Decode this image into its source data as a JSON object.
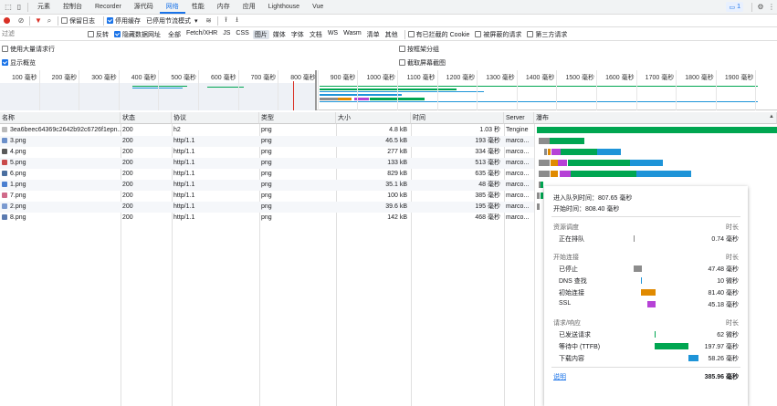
{
  "tabs": [
    "元素",
    "控制台",
    "Recorder",
    "源代码",
    "网络",
    "性能",
    "内存",
    "应用",
    "Lighthouse",
    "Vue"
  ],
  "active_tab": "网络",
  "issues_badge": "1",
  "toolbar": {
    "preserve_log": "保留日志",
    "disable_cache": "停用缓存",
    "throttling": "已停用节流模式"
  },
  "filter": {
    "placeholder": "过滤",
    "invert": "反转",
    "hide_data_urls": "隐藏数据网址",
    "types": [
      "全部",
      "Fetch/XHR",
      "JS",
      "CSS",
      "图片",
      "媒体",
      "字体",
      "文档",
      "WS",
      "Wasm",
      "清单",
      "其他"
    ],
    "active_type": "图片",
    "blocked_cookies": "有已拦截的 Cookie",
    "blocked_requests": "被屏蔽的请求",
    "third_party": "第三方请求"
  },
  "options": {
    "large_rows": "使用大量请求行",
    "group_by_frame": "按框架分组",
    "show_overview": "显示概览",
    "capture_screenshots": "截取屏幕截图"
  },
  "overview_ticks": [
    "100 毫秒",
    "200 毫秒",
    "300 毫秒",
    "400 毫秒",
    "500 毫秒",
    "600 毫秒",
    "700 毫秒",
    "800 毫秒",
    "900 毫秒",
    "1000 毫秒",
    "1100 毫秒",
    "1200 毫秒",
    "1300 毫秒",
    "1400 毫秒",
    "1500 毫秒",
    "1600 毫秒",
    "1700 毫秒",
    "1800 毫秒",
    "1900 毫秒",
    "2000"
  ],
  "columns": [
    "名称",
    "状态",
    "协议",
    "类型",
    "大小",
    "时间",
    "Server",
    "瀑布"
  ],
  "rows": [
    {
      "name": "3ea6beec64369c2642b92c6726f1epn...",
      "status": "200",
      "protocol": "h2",
      "type": "png",
      "size": "4.8 kB",
      "time": "1.03 秒",
      "server": "Tengine",
      "icon": "#bbbbbb"
    },
    {
      "name": "3.png",
      "status": "200",
      "protocol": "http/1.1",
      "type": "png",
      "size": "46.5 kB",
      "time": "193 毫秒",
      "server": "marco...",
      "icon": "#6b8fc9"
    },
    {
      "name": "4.png",
      "status": "200",
      "protocol": "http/1.1",
      "type": "png",
      "size": "277 kB",
      "time": "334 毫秒",
      "server": "marco...",
      "icon": "#5a5a5a"
    },
    {
      "name": "5.png",
      "status": "200",
      "protocol": "http/1.1",
      "type": "png",
      "size": "133 kB",
      "time": "513 毫秒",
      "server": "marco...",
      "icon": "#c94a4a"
    },
    {
      "name": "6.png",
      "status": "200",
      "protocol": "http/1.1",
      "type": "png",
      "size": "829 kB",
      "time": "635 毫秒",
      "server": "marco...",
      "icon": "#4b6fa0"
    },
    {
      "name": "1.png",
      "status": "200",
      "protocol": "http/1.1",
      "type": "png",
      "size": "35.1 kB",
      "time": "48 毫秒",
      "server": "marco...",
      "icon": "#4a7fd0"
    },
    {
      "name": "7.png",
      "status": "200",
      "protocol": "http/1.1",
      "type": "png",
      "size": "100 kB",
      "time": "385 毫秒",
      "server": "marco...",
      "icon": "#d06a8a"
    },
    {
      "name": "2.png",
      "status": "200",
      "protocol": "http/1.1",
      "type": "png",
      "size": "39.6 kB",
      "time": "195 毫秒",
      "server": "marco...",
      "icon": "#7a9ad0"
    },
    {
      "name": "8.png",
      "status": "200",
      "protocol": "http/1.1",
      "type": "png",
      "size": "142 kB",
      "time": "468 毫秒",
      "server": "marco...",
      "icon": "#5a7ab0"
    }
  ],
  "timing": {
    "queued_at": "进入队列时间：807.65 毫秒",
    "started_at": "开始时间：808.40 毫秒",
    "queueing_header": "资源调度",
    "duration_label": "时长",
    "queueing": [
      {
        "label": "正在排队",
        "value": "0.74 毫秒"
      }
    ],
    "connection_header": "开始连接",
    "connection": [
      {
        "label": "已停止",
        "value": "47.48 毫秒"
      },
      {
        "label": "DNS 查找",
        "value": "10 微秒"
      },
      {
        "label": "初始连接",
        "value": "81.40 毫秒"
      },
      {
        "label": "SSL",
        "value": "45.18 毫秒"
      }
    ],
    "response_header": "请求/响应",
    "response": [
      {
        "label": "已发送请求",
        "value": "62 微秒"
      },
      {
        "label": "等待中 (TTFB)",
        "value": "197.97 毫秒"
      },
      {
        "label": "下载内容",
        "value": "58.26 毫秒"
      }
    ],
    "explanation": "说明",
    "total": "385.96 毫秒"
  },
  "colors": {
    "accent": "#1a73e8",
    "waiting": "#00a651",
    "download": "#1e94d8",
    "stalled": "#8c8c8c",
    "connect": "#e08a00",
    "ssl": "#b642d6"
  }
}
